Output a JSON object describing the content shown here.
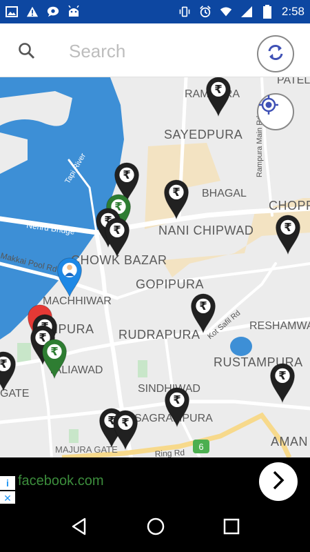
{
  "status_bar": {
    "time": "2:58",
    "left_icons": [
      "image-icon",
      "alert-icon",
      "chat-icon",
      "android-icon"
    ],
    "right_icons": [
      "vibrate-icon",
      "alarm-icon",
      "wifi-icon",
      "signal-icon",
      "battery-icon"
    ]
  },
  "search": {
    "placeholder": "Search",
    "value": ""
  },
  "map": {
    "area_labels": {
      "rampura": "RAMPURA",
      "patel": "PATEL",
      "sayedpura": "SAYEDPURA",
      "bhagal": "BHAGAL",
      "chopra": "CHOPRA",
      "nani_chipwad": "NANI CHIPWAD",
      "chowk_bazar": "CHOWK BAZAR",
      "gopipura": "GOPIPURA",
      "machhiwar": "MACHHIWAR",
      "nanpura": "NANPURA",
      "rudrapura": "RUDRAPURA",
      "reshamwa": "RESHAMWA",
      "rustampura": "RUSTAMPURA",
      "taliawad": "TALIAWAD",
      "sindhiwad": "SINDHIWAD",
      "sagrampura": "SAGRAMPURA",
      "gate": "GATE",
      "majura_gate": "MAJURA GATE",
      "aman": "AMAN"
    },
    "road_labels": {
      "tapi_river": "Tapi River",
      "nehru_bridge": "Nehru Bridge",
      "makkai_pool_rd": "Makkai Pool Rd",
      "kot_safil_rd": "Kot Safil Rd",
      "rampura_main_rd": "Rampura Main Rd",
      "ring_rd": "Ring Rd",
      "route_6": "6"
    },
    "marker_glyph": "₹",
    "colors": {
      "atm_marker": "#212121",
      "active_marker": "#2e7d32",
      "user_marker": "#1e88e5",
      "error_marker": "#e53935",
      "water": "#3d8fd6",
      "park": "#c8e6c9",
      "sand": "#f3e3c2"
    }
  },
  "ad": {
    "text": "facebook.com",
    "info_glyph": "i",
    "close_glyph": "✕",
    "arrow_glyph": "›"
  }
}
